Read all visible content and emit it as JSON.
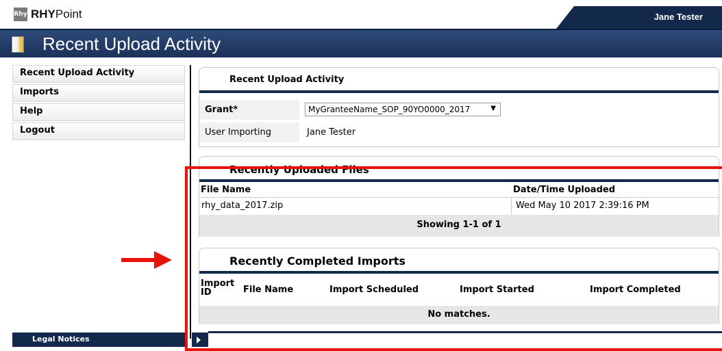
{
  "header": {
    "logo_badge": "Rhy",
    "logo_bold": "RHY",
    "logo_rest": "Point",
    "user_name": "Jane Tester",
    "page_title": "Recent Upload Activity"
  },
  "sidebar": {
    "items": [
      {
        "label": "Recent Upload Activity"
      },
      {
        "label": "Imports"
      },
      {
        "label": "Help"
      },
      {
        "label": "Logout"
      }
    ]
  },
  "activity_panel": {
    "title": "Recent Upload Activity",
    "grant_label": "Grant",
    "grant_required_mark": "*",
    "grant_value": "MyGranteeName_SOP_90YO0000_2017",
    "user_importing_label": "User Importing",
    "user_importing_value": "Jane Tester"
  },
  "files_panel": {
    "title": "Recently Uploaded Files",
    "columns": [
      "File Name",
      "Date/Time Uploaded"
    ],
    "rows": [
      {
        "file_name": "rhy_data_2017.zip",
        "uploaded": "Wed May 10 2017 2:39:16 PM"
      }
    ],
    "footer": "Showing 1-1 of 1"
  },
  "imports_panel": {
    "title": "Recently Completed Imports",
    "columns": [
      "Import ID",
      "File Name",
      "Import Scheduled",
      "Import Started",
      "Import Completed"
    ],
    "empty_text": "No matches."
  },
  "footer": {
    "legal_notices": "Legal Notices"
  },
  "colors": {
    "navy": "#13294b",
    "annotation_red": "#e8140c"
  }
}
